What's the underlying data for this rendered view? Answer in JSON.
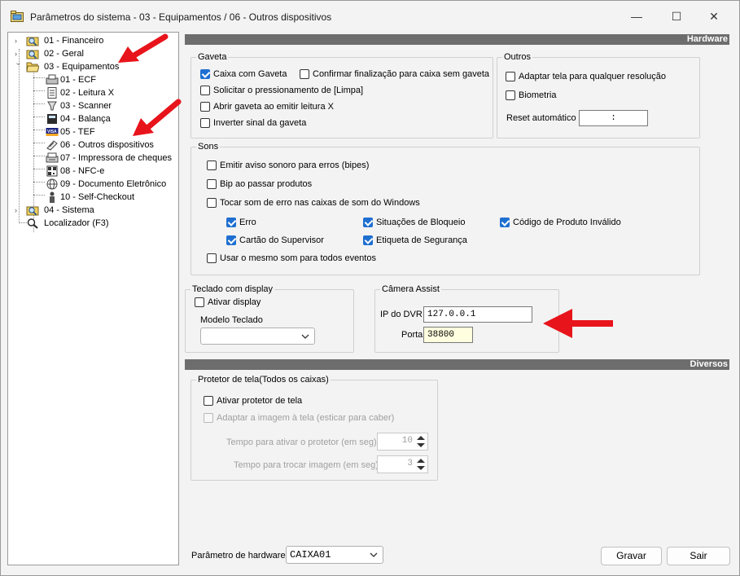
{
  "window": {
    "title": "Parâmetros do sistema - 03 - Equipamentos / 06 - Outros dispositivos",
    "minimize": "—",
    "maximize": "☐",
    "close": "✕"
  },
  "tree": {
    "items": [
      {
        "label": "01 - Financeiro",
        "icon": "search-folder-icon"
      },
      {
        "label": "02 - Geral",
        "icon": "search-folder-icon"
      },
      {
        "label": "03 - Equipamentos",
        "icon": "open-folder-icon"
      },
      {
        "label": "01 - ECF",
        "icon": "ecf-printer-icon"
      },
      {
        "label": "02 - Leitura X",
        "icon": "document-icon"
      },
      {
        "label": "03 - Scanner",
        "icon": "scanner-icon"
      },
      {
        "label": "04 - Balança",
        "icon": "scale-icon"
      },
      {
        "label": "05 - TEF",
        "icon": "visa-card-icon"
      },
      {
        "label": "06 - Outros dispositivos",
        "icon": "devices-icon"
      },
      {
        "label": "07 - Impressora de cheques",
        "icon": "cheque-printer-icon"
      },
      {
        "label": "08 - NFC-e",
        "icon": "qr-code-icon"
      },
      {
        "label": "09 - Documento Eletrônico",
        "icon": "globe-icon"
      },
      {
        "label": "10 - Self-Checkout",
        "icon": "person-kiosk-icon"
      },
      {
        "label": "04 - Sistema",
        "icon": "search-folder-icon"
      },
      {
        "label": "Localizador (F3)",
        "icon": "magnifier-icon"
      }
    ]
  },
  "hardware": {
    "header": "Hardware",
    "gaveta": {
      "title": "Gaveta",
      "caixa_com_gaveta": "Caixa com Gaveta",
      "confirmar_finalizacao": "Confirmar finalização para caixa sem gaveta",
      "solicitar_pressionamento": "Solicitar o pressionamento de [Limpa]",
      "abrir_gaveta": "Abrir gaveta ao emitir leitura X",
      "inverter_sinal": "Inverter sinal da gaveta"
    },
    "outros": {
      "title": "Outros",
      "adaptar_tela": "Adaptar tela para qualquer resolução",
      "biometria": "Biometria",
      "reset_label": "Reset automático",
      "reset_value": ":"
    },
    "sons": {
      "title": "Sons",
      "emitir_aviso": "Emitir aviso sonoro para erros (bipes)",
      "bip_produtos": "Bip ao passar produtos",
      "tocar_som": "Tocar som de erro nas caixas de som do Windows",
      "erro": "Erro",
      "situacoes_bloqueio": "Situações de Bloqueio",
      "codigo_invalido": "Código de Produto Inválido",
      "cartao_supervisor": "Cartão do Supervisor",
      "etiqueta_seguranca": "Etiqueta de Segurança",
      "usar_mesmo_som": "Usar o mesmo som para todos eventos"
    },
    "teclado": {
      "title": "Teclado com display",
      "ativar_display": "Ativar display",
      "modelo_label": "Modelo Teclado",
      "modelo_value": ""
    },
    "camera": {
      "title": "Câmera Assist",
      "ip_label": "IP do DVR",
      "ip_value": "127.0.0.1",
      "porta_label": "Porta",
      "porta_value": "38800"
    }
  },
  "diversos": {
    "header": "Diversos",
    "protetor": {
      "title": "Protetor de tela(Todos os caixas)",
      "ativar": "Ativar protetor de tela",
      "adaptar": "Adaptar a imagem à tela (esticar para caber)",
      "tempo_ativar_label": "Tempo para ativar o protetor (em seg):",
      "tempo_ativar_value": "10",
      "tempo_trocar_label": "Tempo para trocar imagem (em seg):",
      "tempo_trocar_value": "3"
    }
  },
  "footer": {
    "param_label": "Parâmetro de hardware",
    "param_value": "CAIXA01",
    "gravar": "Gravar",
    "sair": "Sair"
  },
  "colors": {
    "annotation_arrow": "#e8141b",
    "checkbox_checked": "#1f6fd1",
    "section_header": "#6d6d6d"
  }
}
